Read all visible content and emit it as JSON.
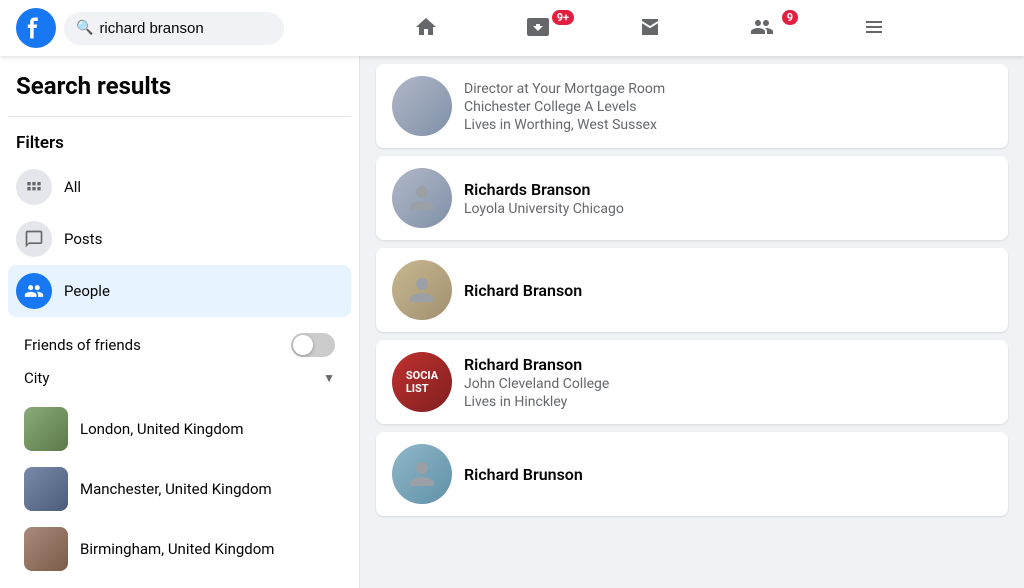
{
  "header": {
    "logo": "f",
    "search": {
      "value": "richard branson",
      "placeholder": "Search"
    },
    "nav": [
      {
        "id": "home",
        "icon": "home",
        "badge": null
      },
      {
        "id": "video",
        "icon": "video",
        "badge": "9+"
      },
      {
        "id": "marketplace",
        "icon": "store",
        "badge": null
      },
      {
        "id": "friends",
        "icon": "people",
        "badge": "9"
      },
      {
        "id": "menu",
        "icon": "grid",
        "badge": null
      }
    ]
  },
  "sidebar": {
    "title": "Search results",
    "filters_label": "Filters",
    "filters": [
      {
        "id": "all",
        "label": "All",
        "icon": "⊞",
        "active": false
      },
      {
        "id": "posts",
        "label": "Posts",
        "icon": "💬",
        "active": false
      },
      {
        "id": "people",
        "label": "People",
        "icon": "👥",
        "active": true
      }
    ],
    "sub_filters": {
      "friends_of_friends": {
        "label": "Friends of friends",
        "enabled": false
      },
      "city": {
        "label": "City",
        "items": [
          {
            "id": "london",
            "name": "London, United Kingdom"
          },
          {
            "id": "manchester",
            "name": "Manchester, United Kingdom"
          },
          {
            "id": "birmingham",
            "name": "Birmingham, United Kingdom"
          }
        ]
      }
    }
  },
  "results": {
    "partial_top": {
      "detail1": "Director at Your Mortgage Room",
      "detail2": "Chichester College A Levels",
      "detail3": "Lives in Worthing, West Sussex"
    },
    "people": [
      {
        "id": 1,
        "name": "Richards Branson",
        "detail1": "Loyola University Chicago",
        "detail2": null,
        "detail3": null,
        "avatar_class": "avatar-1"
      },
      {
        "id": 2,
        "name": "Richard Branson",
        "detail1": null,
        "detail2": null,
        "detail3": null,
        "avatar_class": "avatar-2"
      },
      {
        "id": 3,
        "name": "Richard Branson",
        "detail1": "John Cleveland College",
        "detail2": null,
        "detail3": "Lives in Hinckley",
        "avatar_class": "avatar-4"
      },
      {
        "id": 4,
        "name": "Richard Brunson",
        "detail1": null,
        "detail2": null,
        "detail3": null,
        "avatar_class": "avatar-5"
      }
    ]
  }
}
